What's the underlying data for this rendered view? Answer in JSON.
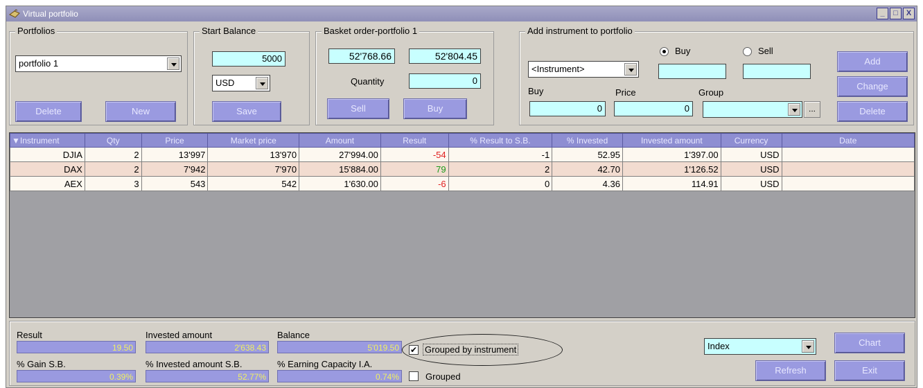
{
  "window": {
    "title": "Virtual portfolio"
  },
  "portfolios": {
    "title": "Portfolios",
    "selected": "portfolio 1",
    "delete_label": "Delete",
    "new_label": "New"
  },
  "start_balance": {
    "title": "Start Balance",
    "value": "5000",
    "currency": "USD",
    "save_label": "Save"
  },
  "basket": {
    "title": "Basket order-portfolio 1",
    "sell_value": "52'768.66",
    "buy_value": "52'804.45",
    "quantity_label": "Quantity",
    "quantity_value": "0",
    "sell_label": "Sell",
    "buy_label": "Buy"
  },
  "add_instrument": {
    "title": "Add instrument to portfolio",
    "instrument": "<Instrument>",
    "buy_radio": "Buy",
    "sell_radio": "Sell",
    "buy_label": "Buy",
    "price_label": "Price",
    "group_label": "Group",
    "buy_value": "0",
    "price_value": "0",
    "dots": "...",
    "add_label": "Add",
    "change_label": "Change",
    "delete_label": "Delete"
  },
  "grid": {
    "headers": [
      "Instrument",
      "Qty",
      "Price",
      "Market price",
      "Amount",
      "Result",
      "% Result to S.B.",
      "% Invested",
      "Invested amount",
      "Currency",
      "Date"
    ],
    "rows": [
      [
        "DJIA",
        "2",
        "13'997",
        "13'970",
        "27'994.00",
        "-54",
        "-1",
        "52.95",
        "1'397.00",
        "USD",
        ""
      ],
      [
        "DAX",
        "2",
        "7'942",
        "7'970",
        "15'884.00",
        "79",
        "2",
        "42.70",
        "1'126.52",
        "USD",
        ""
      ],
      [
        "AEX",
        "3",
        "543",
        "542",
        "1'630.00",
        "-6",
        "0",
        "4.36",
        "114.91",
        "USD",
        ""
      ]
    ]
  },
  "summary": {
    "result_label": "Result",
    "result_value": "19.50",
    "invested_label": "Invested amount",
    "invested_value": "2'638.43",
    "balance_label": "Balance",
    "balance_value": "5'019.50",
    "gain_label": "% Gain S.B.",
    "gain_value": "0.39%",
    "invested_pct_label": "% Invested amount S.B.",
    "invested_pct_value": "52.77%",
    "earning_label": "% Earning Capacity I.A.",
    "earning_value": "0.74%",
    "grouped_by_instrument": "Grouped by instrument",
    "grouped": "Grouped",
    "index_select": "Index",
    "chart_label": "Chart",
    "refresh_label": "Refresh",
    "exit_label": "Exit"
  },
  "colors": {
    "accent": "#9a9ae0",
    "input": "#c8ffff",
    "negative": "#e02020",
    "positive": "#1a9a1a"
  }
}
